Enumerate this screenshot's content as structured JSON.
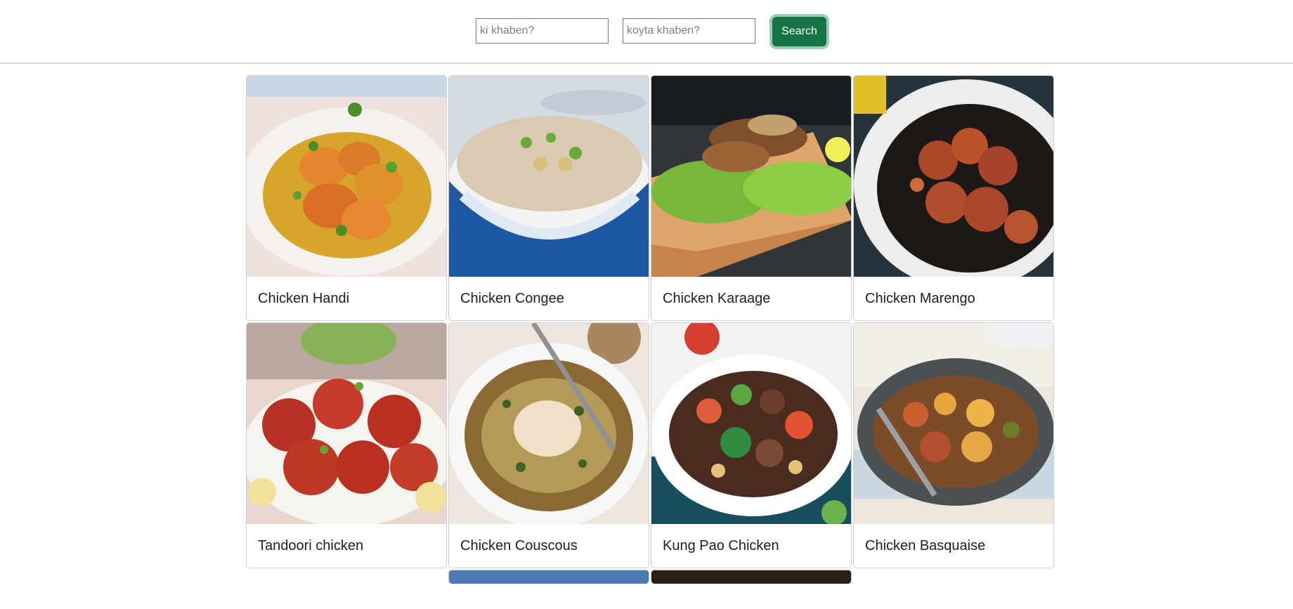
{
  "search": {
    "food_placeholder": "ki khaben?",
    "quantity_placeholder": "koyta khaben?",
    "button_label": "Search",
    "button_color": "#157347"
  },
  "recipes": [
    {
      "name": "Chicken Handi"
    },
    {
      "name": "Chicken Congee"
    },
    {
      "name": "Chicken Karaage"
    },
    {
      "name": "Chicken Marengo"
    },
    {
      "name": "Tandoori chicken"
    },
    {
      "name": "Chicken Couscous"
    },
    {
      "name": "Kung Pao Chicken"
    },
    {
      "name": "Chicken Basquaise"
    }
  ]
}
